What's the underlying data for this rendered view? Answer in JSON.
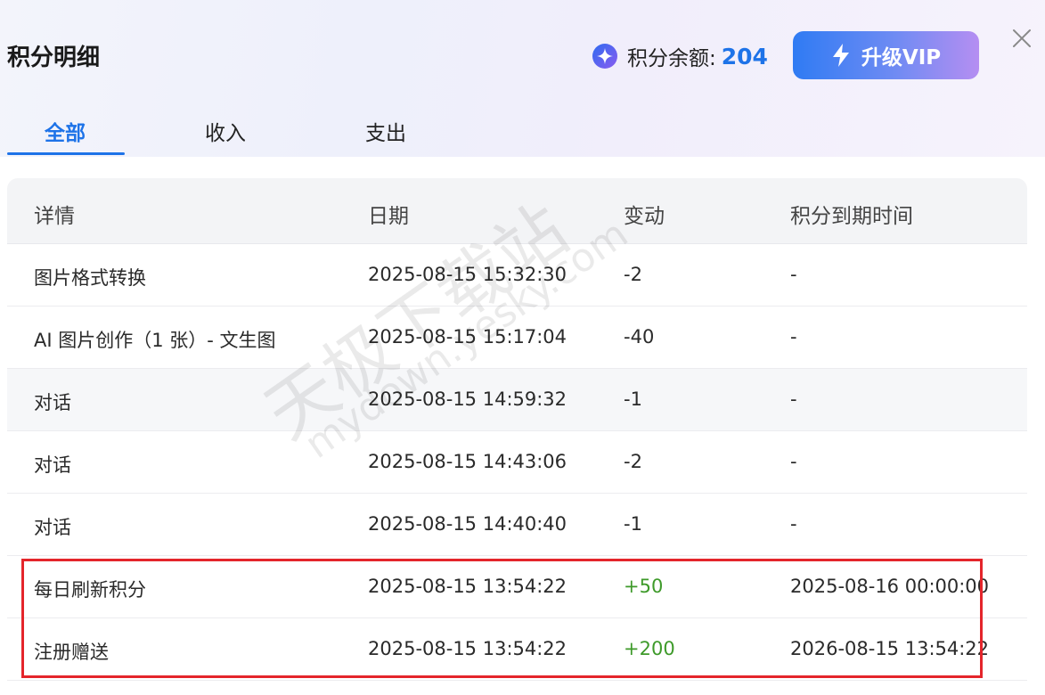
{
  "header": {
    "title": "积分明细",
    "balance_label": "积分余额:",
    "balance_value": "204",
    "upgrade_label": "升级VIP"
  },
  "tabs": [
    {
      "label": "全部",
      "active": true
    },
    {
      "label": "收入",
      "active": false
    },
    {
      "label": "支出",
      "active": false
    }
  ],
  "table": {
    "headers": [
      "详情",
      "日期",
      "变动",
      "积分到期时间"
    ],
    "rows": [
      {
        "detail": "图片格式转换",
        "date": "2025-08-15 15:32:30",
        "change": "-2",
        "expiry": "-"
      },
      {
        "detail": "AI 图片创作（1 张）- 文生图",
        "date": "2025-08-15 15:17:04",
        "change": "-40",
        "expiry": "-"
      },
      {
        "detail": "对话",
        "date": "2025-08-15 14:59:32",
        "change": "-1",
        "expiry": "-"
      },
      {
        "detail": "对话",
        "date": "2025-08-15 14:43:06",
        "change": "-2",
        "expiry": "-"
      },
      {
        "detail": "对话",
        "date": "2025-08-15 14:40:40",
        "change": "-1",
        "expiry": "-"
      },
      {
        "detail": "每日刷新积分",
        "date": "2025-08-15 13:54:22",
        "change": "+50",
        "expiry": "2025-08-16 00:00:00"
      },
      {
        "detail": "注册赠送",
        "date": "2025-08-15 13:54:22",
        "change": "+200",
        "expiry": "2026-08-15 13:54:22"
      }
    ]
  },
  "watermark": {
    "line1": "天极下载站",
    "line2": "mydown.yesky.com"
  },
  "colors": {
    "accent": "#1e73e8",
    "positive": "#3e9a2a",
    "highlight_border": "#e4252b"
  },
  "icons": {
    "balance": "sparkle-star-icon",
    "upgrade": "lightning-bolt-icon",
    "close": "close-icon"
  }
}
